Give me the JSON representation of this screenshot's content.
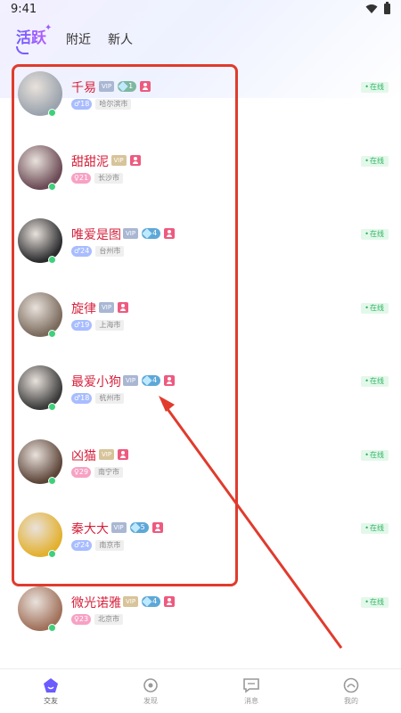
{
  "status_bar": {
    "time": "9:41"
  },
  "tabs": [
    {
      "label": "活跃",
      "active": true
    },
    {
      "label": "附近",
      "active": false
    },
    {
      "label": "新人",
      "active": false
    }
  ],
  "users": [
    {
      "name": "千易",
      "vip": "VIP",
      "vip_tier": "silver",
      "level": "1",
      "level_color": "green",
      "gender": "male",
      "age": "18",
      "city": "哈尔滨市",
      "status": "在线",
      "avatar_color": "#9aa3ad"
    },
    {
      "name": "甜甜泥",
      "vip": "VIP",
      "vip_tier": "gold",
      "level": "",
      "level_color": "",
      "gender": "female",
      "age": "21",
      "city": "长沙市",
      "status": "在线",
      "avatar_color": "#6b4a55"
    },
    {
      "name": "唯爱是图",
      "vip": "VIP",
      "vip_tier": "silver",
      "level": "4",
      "level_color": "blue",
      "gender": "male",
      "age": "24",
      "city": "台州市",
      "status": "在线",
      "avatar_color": "#2b2b2e"
    },
    {
      "name": "旋律",
      "vip": "VIP",
      "vip_tier": "silver",
      "level": "",
      "level_color": "",
      "gender": "male",
      "age": "19",
      "city": "上海市",
      "status": "在线",
      "avatar_color": "#7a6a5c"
    },
    {
      "name": "最爱小狗",
      "vip": "VIP",
      "vip_tier": "silver",
      "level": "4",
      "level_color": "blue",
      "gender": "male",
      "age": "18",
      "city": "杭州市",
      "status": "在线",
      "avatar_color": "#3a3a3a"
    },
    {
      "name": "凶猫",
      "vip": "VIP",
      "vip_tier": "gold",
      "level": "",
      "level_color": "",
      "gender": "female",
      "age": "29",
      "city": "南宁市",
      "status": "在线",
      "avatar_color": "#5c4438"
    },
    {
      "name": "秦大大",
      "vip": "VIP",
      "vip_tier": "silver",
      "level": "5",
      "level_color": "blue",
      "gender": "male",
      "age": "24",
      "city": "南京市",
      "status": "在线",
      "avatar_color": "#e3b02e"
    },
    {
      "name": "微光诺雅",
      "vip": "VIP",
      "vip_tier": "gold",
      "level": "4",
      "level_color": "blue",
      "gender": "female",
      "age": "23",
      "city": "北京市",
      "status": "在线",
      "avatar_color": "#a0705a"
    }
  ],
  "bottom_nav": [
    {
      "label": "交友",
      "icon": "home-icon",
      "active": true
    },
    {
      "label": "发现",
      "icon": "discover-icon",
      "active": false
    },
    {
      "label": "消息",
      "icon": "message-icon",
      "active": false
    },
    {
      "label": "我的",
      "icon": "profile-icon",
      "active": false
    }
  ],
  "colors": {
    "accent": "#7b5cff",
    "name": "#d6213b",
    "online": "#2fb463",
    "annotation": "#e03b2d"
  }
}
